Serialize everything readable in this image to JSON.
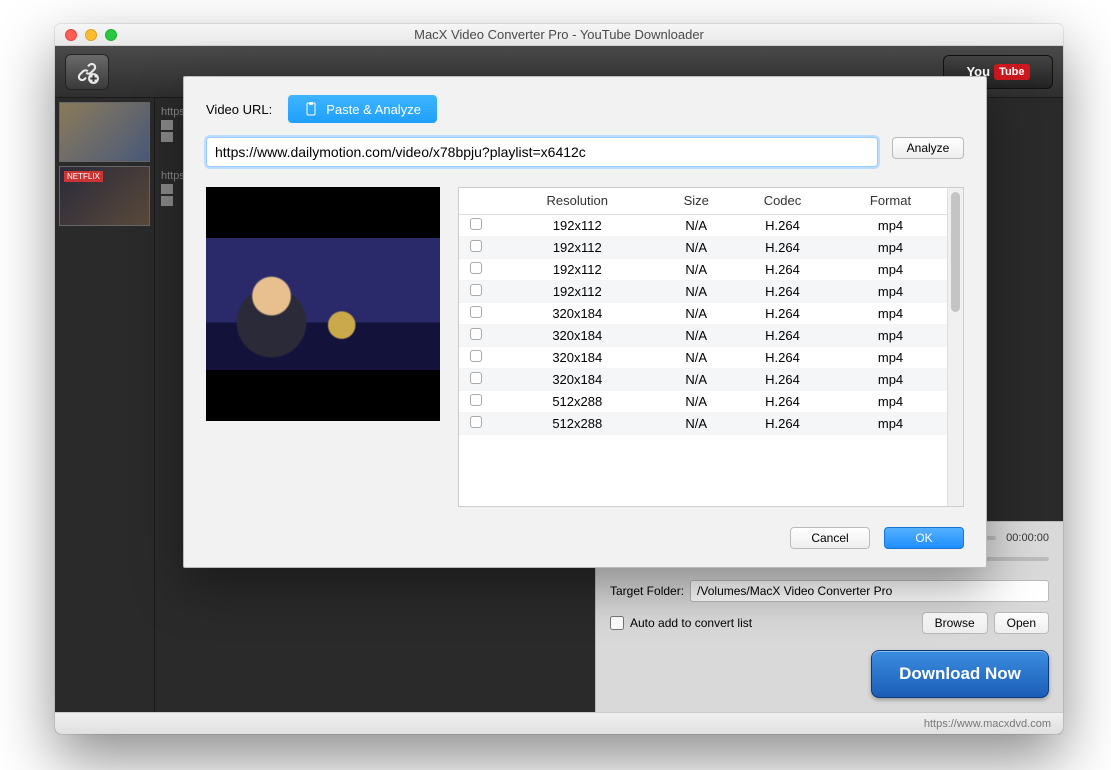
{
  "window": {
    "title": "MacX Video Converter Pro - YouTube Downloader"
  },
  "toolbar": {
    "youtube_prefix": "You",
    "youtube_suffix": "Tube"
  },
  "sidebar": {
    "items": [
      {
        "url_prefix": "https"
      },
      {
        "url_prefix": "https"
      }
    ]
  },
  "modal": {
    "url_label": "Video URL:",
    "paste_label": "Paste & Analyze",
    "url_value": "https://www.dailymotion.com/video/x78bpju?playlist=x6412c",
    "analyze_label": "Analyze",
    "table": {
      "headers": {
        "resolution": "Resolution",
        "size": "Size",
        "codec": "Codec",
        "format": "Format"
      },
      "rows": [
        {
          "resolution": "192x112",
          "size": "N/A",
          "codec": "H.264",
          "format": "mp4"
        },
        {
          "resolution": "192x112",
          "size": "N/A",
          "codec": "H.264",
          "format": "mp4"
        },
        {
          "resolution": "192x112",
          "size": "N/A",
          "codec": "H.264",
          "format": "mp4"
        },
        {
          "resolution": "192x112",
          "size": "N/A",
          "codec": "H.264",
          "format": "mp4"
        },
        {
          "resolution": "320x184",
          "size": "N/A",
          "codec": "H.264",
          "format": "mp4"
        },
        {
          "resolution": "320x184",
          "size": "N/A",
          "codec": "H.264",
          "format": "mp4"
        },
        {
          "resolution": "320x184",
          "size": "N/A",
          "codec": "H.264",
          "format": "mp4"
        },
        {
          "resolution": "320x184",
          "size": "N/A",
          "codec": "H.264",
          "format": "mp4"
        },
        {
          "resolution": "512x288",
          "size": "N/A",
          "codec": "H.264",
          "format": "mp4"
        },
        {
          "resolution": "512x288",
          "size": "N/A",
          "codec": "H.264",
          "format": "mp4"
        }
      ]
    },
    "cancel_label": "Cancel",
    "ok_label": "OK"
  },
  "preview": {
    "time": "00:00:00",
    "target_label": "Target Folder:",
    "target_value": "/Volumes/MacX Video Converter Pro",
    "auto_add_label": "Auto add to convert list",
    "browse_label": "Browse",
    "open_label": "Open",
    "download_label": "Download Now"
  },
  "status": {
    "url": "https://www.macxdvd.com"
  }
}
